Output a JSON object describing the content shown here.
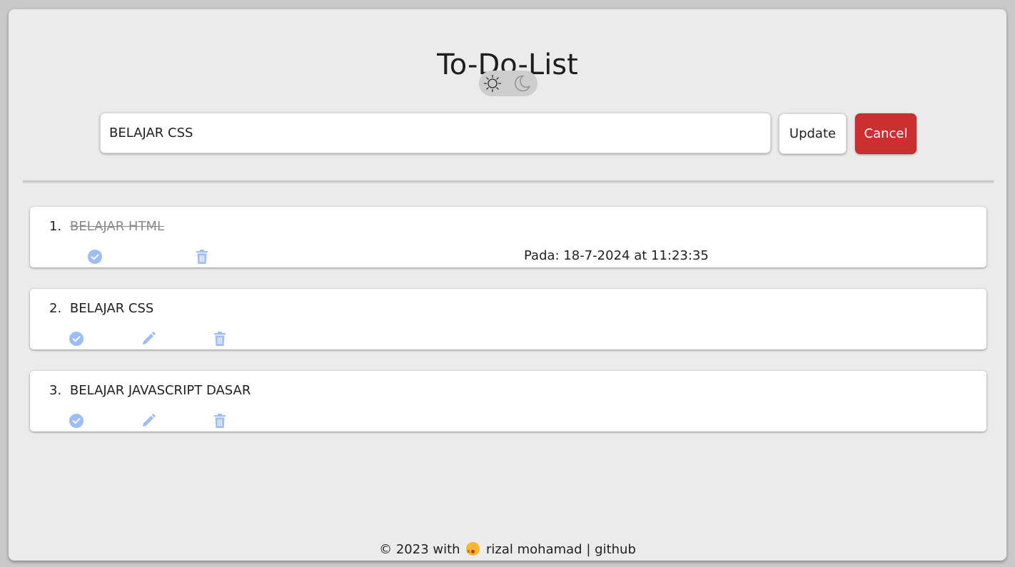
{
  "app": {
    "title": "To-Do-List"
  },
  "theme_toggle": {
    "light_icon": "sun-icon",
    "dark_icon": "moon-icon"
  },
  "form": {
    "input_value": "BELAJAR CSS",
    "update_label": "Update",
    "cancel_label": "Cancel"
  },
  "todos": [
    {
      "number": "1.",
      "text": "BELAJAR HTML",
      "completed": true,
      "completed_at": "Pada: 18-7-2024 at 11:23:35"
    },
    {
      "number": "2.",
      "text": "BELAJAR CSS",
      "completed": false
    },
    {
      "number": "3.",
      "text": "BELAJAR JAVASCRIPT DASAR",
      "completed": false
    }
  ],
  "footer": {
    "prefix": "© 2023 with",
    "author": "rizal mohamad",
    "separator": "|",
    "link": "github"
  },
  "colors": {
    "accent_icon": "#9ebcf6",
    "cancel": "#cb2f2f",
    "background": "#ebebeb"
  }
}
